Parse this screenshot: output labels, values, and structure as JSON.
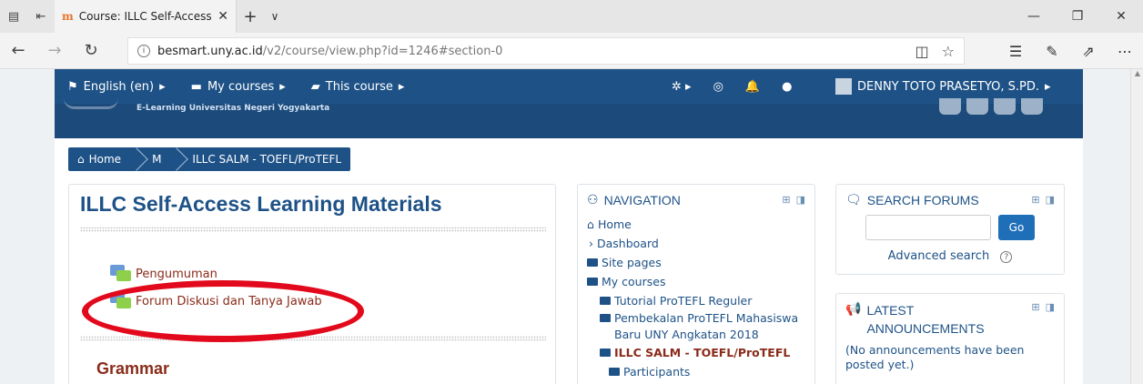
{
  "browser": {
    "tab_title": "Course: ILLC Self-Access",
    "tab_close": "✕",
    "new_tab": "+",
    "tab_menu": "∨",
    "url_domain": "besmart.uny.ac.id",
    "url_path": "/v2/course/view.php?id=1246#section-0",
    "favicon": "m",
    "icons": [
      "tab-overview-icon",
      "set-aside-icon",
      "back-icon",
      "forward-icon",
      "refresh-icon",
      "info-icon",
      "reading-view-icon",
      "favorite-star-icon",
      "favorites-hub-icon",
      "pen-icon",
      "share-icon",
      "more-icon",
      "minimize-icon",
      "restore-icon",
      "close-icon"
    ]
  },
  "topnav": {
    "language": "English (en)",
    "my_courses": "My courses",
    "this_course": "This course",
    "user_name": "DENNY TOTO PRASETYO, S.PD."
  },
  "banner": {
    "text": "E-Learning Universitas Negeri Yogyakarta"
  },
  "breadcrumb": {
    "home": "Home",
    "m": "M",
    "course": "ILLC SALM - TOEFL/ProTEFL"
  },
  "course": {
    "title": "ILLC Self-Access Learning Materials",
    "activities": [
      "Pengumuman",
      "Forum Diskusi dan Tanya Jawab"
    ],
    "section": "Grammar"
  },
  "navigation": {
    "title": "NAVIGATION",
    "items": {
      "home": "Home",
      "dashboard": "Dashboard",
      "site_pages": "Site pages",
      "my_courses": "My courses",
      "course1": "Tutorial ProTEFL Reguler",
      "course2": "Pembekalan ProTEFL Mahasiswa Baru UNY Angkatan 2018",
      "course3": "ILLC SALM - TOEFL/ProTEFL",
      "participants": "Participants"
    }
  },
  "search_forums": {
    "title": "SEARCH FORUMS",
    "button": "Go",
    "advanced": "Advanced search",
    "help": "?"
  },
  "announcements": {
    "title": "LATEST ANNOUNCEMENTS",
    "body": "(No announcements have been posted yet.)"
  },
  "colors": {
    "brand_blue": "#1e5287",
    "annotation_red": "#e2091c",
    "activity_link": "#8a2b1a"
  }
}
